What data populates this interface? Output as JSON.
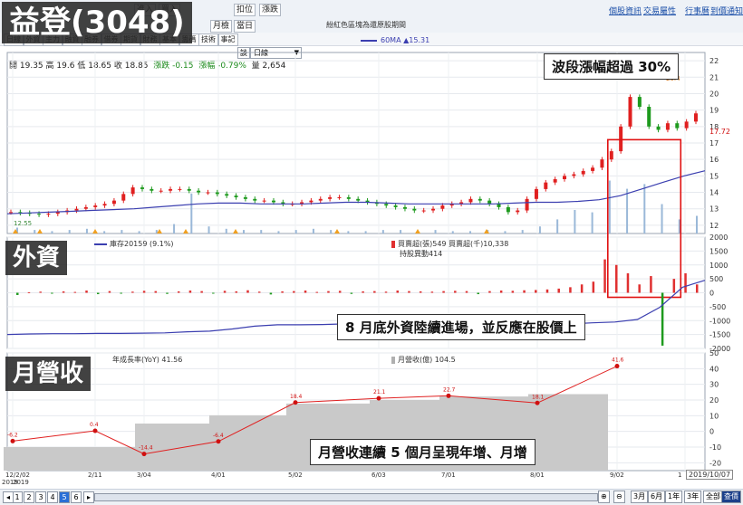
{
  "header": {
    "stock_title": "益登(3048)",
    "center_text": "紛紅色區塊為還原股期間",
    "links": [
      "個股資訊",
      "交易屬性",
      "行事曆",
      "到價通知"
    ],
    "row1_buttons": [
      "進入",
      "買入",
      "扣位",
      "漲跌"
    ],
    "row2_buttons": [
      "月檢",
      "當日"
    ],
    "toolbar": [
      "日線",
      "外資",
      "主力",
      "融資",
      "融券",
      "借券",
      "期貨",
      "財務",
      "基本",
      "籌碼",
      "技術",
      "事記"
    ],
    "zoom_button": "談",
    "period_select": "日線"
  },
  "quote": {
    "open_label": "開",
    "open": "19.35",
    "high_label": "高",
    "high": "19.6",
    "low_label": "低",
    "low": "18.65",
    "close_label": "收",
    "close": "18.85",
    "change_label": "漲跌",
    "change": "-0.15",
    "pct_label": "漲幅",
    "pct": "-0.79%",
    "vol_label": "量",
    "vol": "2,654"
  },
  "price_panel": {
    "ma_legend": "60MA ▲15.31",
    "last_price": "17.72",
    "high_tag": "20.4",
    "low_tag": "12.55",
    "note": "波段漲幅超過 30%"
  },
  "foreign_panel": {
    "label": "外資",
    "legend_holding": "庫存20159 (9.1%)",
    "legend_trade": "買賣超(張)549 買賣超(千)10,338",
    "legend_amount": "持股異動414",
    "note": "8 月底外資陸續進場，並反應在股價上"
  },
  "revenue_panel": {
    "label": "月營收",
    "legend_yoy": "年成長率(YoY) 41.56",
    "legend_rev": "月營收(億) 104.5",
    "note": "月營收連續 5 個月呈現年增、月增"
  },
  "date_axis": {
    "ticks": [
      "12/2/02",
      "2/11",
      "3/04",
      "4/01",
      "5/02",
      "6/03",
      "7/01",
      "8/01",
      "9/02",
      "1"
    ],
    "year_label": "2019",
    "year_label_right": "2019",
    "current_date": "2019/10/07"
  },
  "footer": {
    "pages": [
      "1",
      "2",
      "3",
      "4",
      "5",
      "6"
    ],
    "active_page": "5",
    "ranges": [
      "3月",
      "6月",
      "1年",
      "3年",
      "全部",
      "查價"
    ]
  },
  "chart_data": [
    {
      "type": "candlestick",
      "y_ticks": [
        12,
        13,
        14,
        15,
        16,
        17,
        18,
        19,
        20,
        21,
        22
      ],
      "ylim": [
        11.5,
        22.5
      ],
      "close_path": [
        12.8,
        12.75,
        12.7,
        12.65,
        12.7,
        12.8,
        12.9,
        13.0,
        13.1,
        13.2,
        13.3,
        13.5,
        13.9,
        14.3,
        14.2,
        14.1,
        14.1,
        14.2,
        14.2,
        14.1,
        14.0,
        14.0,
        13.9,
        13.8,
        13.7,
        13.6,
        13.5,
        13.5,
        13.4,
        13.3,
        13.3,
        13.4,
        13.5,
        13.6,
        13.7,
        13.7,
        13.6,
        13.5,
        13.4,
        13.3,
        13.2,
        13.1,
        13.0,
        12.9,
        12.9,
        13.0,
        13.2,
        13.3,
        13.4,
        13.6,
        13.5,
        13.3,
        13.1,
        12.8,
        12.9,
        13.6,
        14.2,
        14.6,
        14.8,
        15.0,
        15.1,
        15.3,
        15.5,
        16.0,
        16.5,
        18.0,
        19.8,
        19.2,
        18.0,
        17.8,
        18.2,
        17.9,
        18.3,
        18.8
      ],
      "ma60_path": [
        12.7,
        12.75,
        12.8,
        12.85,
        12.9,
        12.95,
        13.0,
        13.1,
        13.2,
        13.3,
        13.35,
        13.35,
        13.3,
        13.3,
        13.3,
        13.35,
        13.4,
        13.4,
        13.35,
        13.3,
        13.3,
        13.3,
        13.3,
        13.3,
        13.35,
        13.4,
        13.4,
        13.45,
        13.55,
        13.8,
        14.2,
        14.6,
        15.0,
        15.31
      ],
      "volume_path": [
        0.5,
        0.3,
        0.2,
        0.3,
        0.4,
        0.2,
        0.3,
        0.2,
        0.3,
        0.8,
        3.4,
        0.6,
        0.4,
        0.3,
        0.3,
        0.2,
        0.3,
        0.4,
        0.3,
        0.2,
        0.2,
        0.3,
        0.3,
        0.2,
        0.3,
        0.2,
        0.2,
        0.3,
        0.2,
        0.3,
        0.6,
        1.2,
        2.0,
        1.8,
        4.5,
        3.8,
        4.2,
        2.5,
        1.2,
        1.5
      ],
      "annotations": {
        "highlight_box_days": [
          64,
          71
        ]
      }
    },
    {
      "type": "bar",
      "y_ticks": [
        2000,
        1500,
        1000,
        500,
        0,
        -500,
        -1000,
        -1500,
        -2000
      ],
      "ylim": [
        -2000,
        2000
      ],
      "net_buy_path": [
        -80,
        20,
        40,
        -30,
        50,
        30,
        80,
        -50,
        60,
        -20,
        40,
        70,
        60,
        -40,
        50,
        80,
        60,
        -30,
        70,
        50,
        90,
        40,
        -60,
        50,
        60,
        80,
        30,
        60,
        70,
        -40,
        50,
        60,
        40,
        80,
        60,
        50,
        40,
        60,
        70,
        60,
        -50,
        60,
        80,
        70,
        90,
        100,
        120,
        150,
        200,
        300,
        400,
        1200,
        1000,
        700,
        300,
        600,
        -1900,
        500,
        700,
        300
      ],
      "holding_path": [
        -1500,
        -1480,
        -1470,
        -1470,
        -1460,
        -1460,
        -1450,
        -1440,
        -1400,
        -1380,
        -1300,
        -1200,
        -1150,
        -1150,
        -1140,
        -1120,
        -1050,
        -1050,
        -1040,
        -1060,
        -1080,
        -1080,
        -1120,
        -1140,
        -1150,
        -1120,
        -1080,
        -1050,
        -960,
        -520,
        200,
        450
      ]
    },
    {
      "type": "bar+line",
      "x": [
        "12/02",
        "1/02",
        "2/11",
        "3/04",
        "4/01",
        "5/02",
        "6/03",
        "7/01",
        "8/01",
        "9/02"
      ],
      "yoy_values": [
        -6.2,
        null,
        0.4,
        -14.4,
        -6.4,
        18.4,
        21.1,
        22.7,
        18.1,
        41.6
      ],
      "revenue_relative": [
        0.2,
        0.2,
        0.2,
        0.4,
        0.47,
        0.57,
        0.6,
        0.63,
        0.65,
        0.68
      ],
      "y_ticks": [
        50,
        40,
        30,
        20,
        10,
        0,
        -10,
        -20
      ],
      "ylim": [
        -25,
        50
      ]
    }
  ]
}
